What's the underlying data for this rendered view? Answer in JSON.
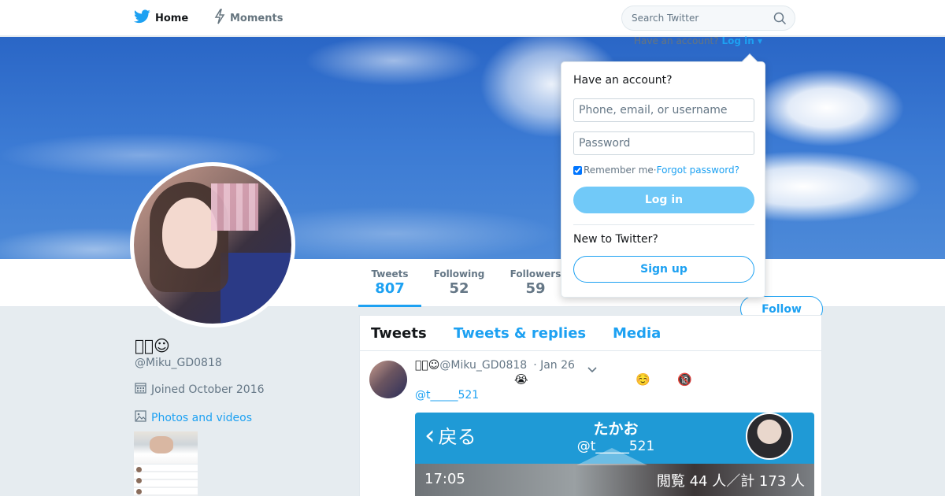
{
  "nav": {
    "home_label": "Home",
    "moments_label": "Moments",
    "home_icon": "twitter-bird-icon",
    "moments_icon": "lightning-icon"
  },
  "search": {
    "placeholder": "Search Twitter",
    "icon": "search-icon"
  },
  "account_prompt": {
    "text": "Have an account?",
    "login_link": "Log in ▾"
  },
  "profile": {
    "display_name": "\u0000\u0000☺",
    "handle": "@Miku_GD0818",
    "joined": "Joined October 2016",
    "photos_link": "Photos and videos",
    "stats": {
      "tweets_label": "Tweets",
      "tweets_value": "807",
      "following_label": "Following",
      "following_value": "52",
      "followers_label": "Followers",
      "followers_value": "59"
    },
    "follow_button": "Follow"
  },
  "timeline": {
    "tabs": [
      "Tweets",
      "Tweets & replies",
      "Media"
    ],
    "tweet": {
      "name": "\u0000\u0000☺",
      "handle": "@Miku_GD0818",
      "time": "· Jan 26",
      "emojis": [
        "😭",
        "☺️",
        "🔞"
      ],
      "mention": "@t_____521",
      "media": {
        "back_label": "戻る",
        "user_name": "たかお",
        "user_handle": "@t_____521",
        "clock": "17:05",
        "views": "閲覧 44 人／計 173 人"
      }
    }
  },
  "login_dropdown": {
    "title": "Have an account?",
    "username_placeholder": "Phone, email, or username",
    "password_placeholder": "Password",
    "remember_me": "Remember me",
    "separator": " · ",
    "forgot_password": "Forgot password?",
    "login_button": "Log in",
    "new_prompt": "New to Twitter?",
    "signup_button": "Sign up"
  },
  "colors": {
    "accent": "#1da1f2",
    "login_button_bg": "#71c9f8",
    "page_bg": "#e6ecf0"
  }
}
